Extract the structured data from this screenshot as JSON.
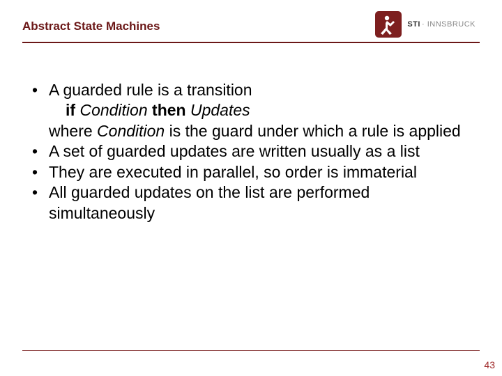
{
  "header": {
    "title": "Abstract State Machines"
  },
  "logo": {
    "brand_bold": "STI",
    "brand_light": "INNSBRUCK"
  },
  "body": {
    "b1_lead": "A guarded rule is a transition",
    "b1_rule_if": "if",
    "b1_rule_cond": " Condition ",
    "b1_rule_then": "then",
    "b1_rule_upd": " Updates",
    "b1_where_pre": "where ",
    "b1_where_cond": "Condition",
    "b1_where_post": " is the guard under which a rule is applied",
    "b2": "A set of guarded updates are written usually as a list",
    "b3": "They are executed in parallel, so order is immaterial",
    "b4": "All guarded updates on the list are performed simultaneously"
  },
  "footer": {
    "page_number": "43"
  }
}
